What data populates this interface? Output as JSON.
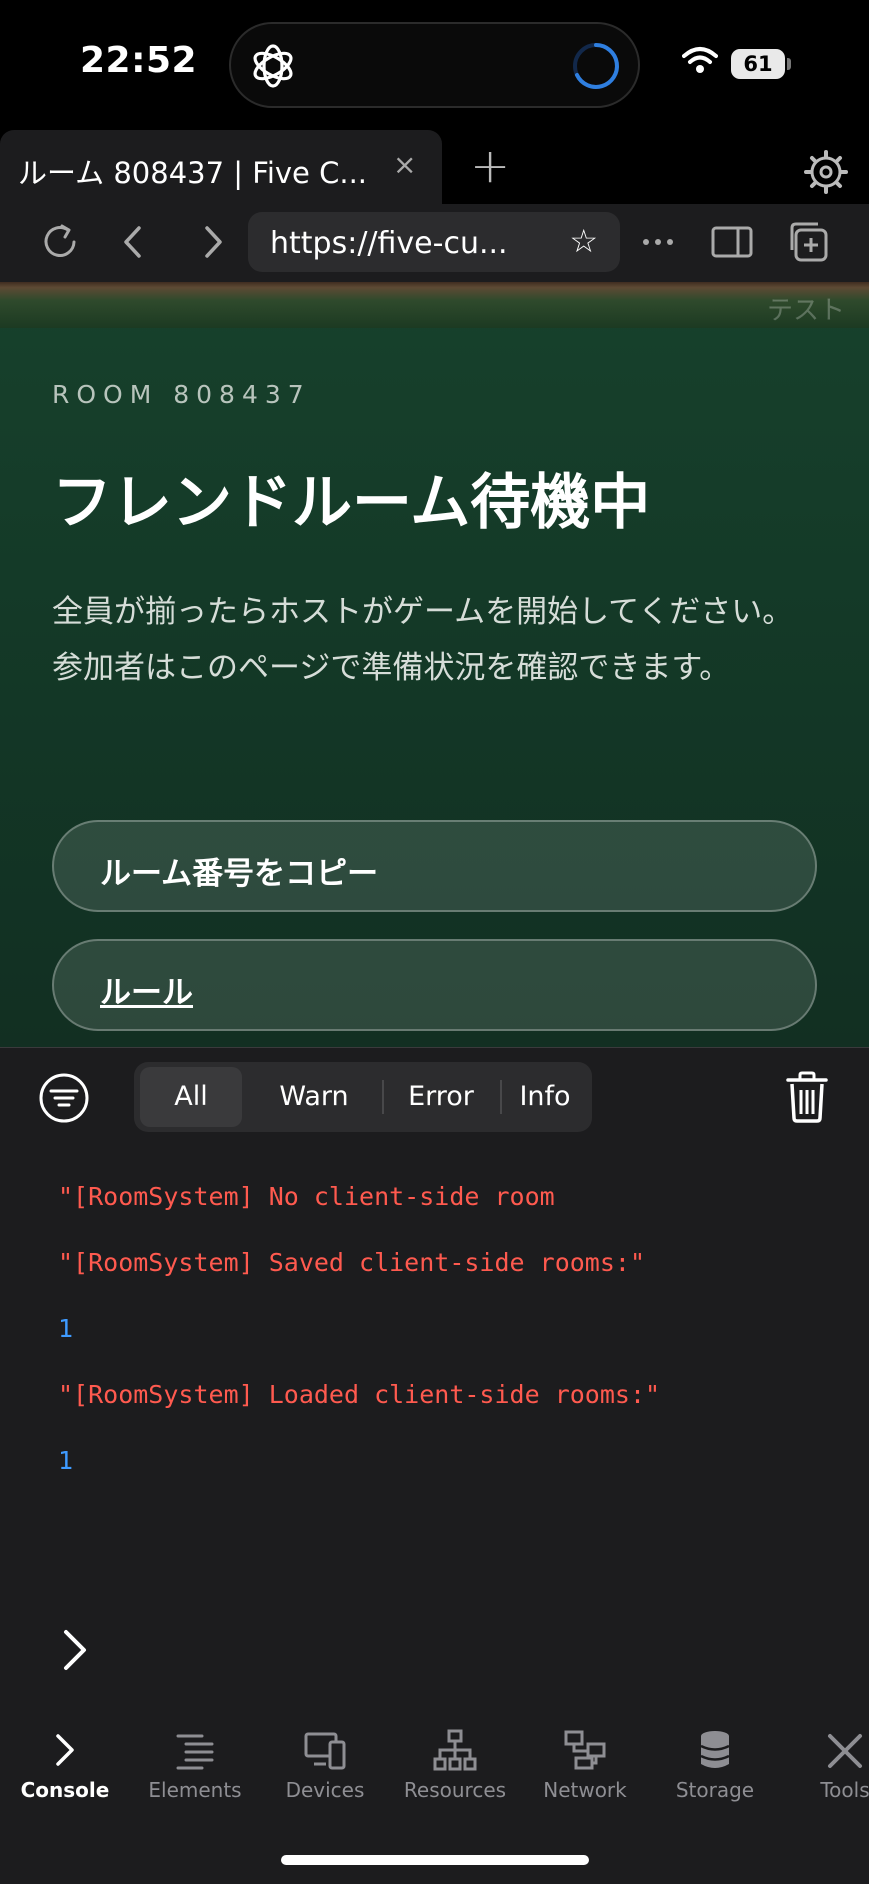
{
  "status_bar": {
    "time": "22:52",
    "battery": "61"
  },
  "browser": {
    "tab_title": "ルーム 808437 | Five C...",
    "tab_close": "×",
    "new_tab": "+",
    "url": "https://five-cu...",
    "bookmark_icon": "☆"
  },
  "page": {
    "banner_text": "テスト",
    "room_label": "ROOM 808437",
    "title": "フレンドルーム待機中",
    "description": "全員が揃ったらホストがゲームを開始してください。参加者はこのページで準備状況を確認できます。",
    "copy_button": "ルーム番号をコピー",
    "rules_button": "ルール"
  },
  "console": {
    "filters": [
      "All",
      "Warn",
      "Error",
      "Info"
    ],
    "active_filter": "All",
    "logs": [
      {
        "type": "string",
        "text": "\"[RoomSystem] No client-side room"
      },
      {
        "type": "string",
        "text": "\"[RoomSystem] Saved client-side rooms:\""
      },
      {
        "type": "number",
        "text": "1"
      },
      {
        "type": "string",
        "text": "\"[RoomSystem] Loaded client-side rooms:\""
      },
      {
        "type": "number",
        "text": "1"
      }
    ]
  },
  "bottom_nav": {
    "items": [
      {
        "label": "Console",
        "icon": "chevron-right-icon",
        "active": true
      },
      {
        "label": "Elements",
        "icon": "elements-icon",
        "active": false
      },
      {
        "label": "Devices",
        "icon": "devices-icon",
        "active": false
      },
      {
        "label": "Resources",
        "icon": "resources-icon",
        "active": false
      },
      {
        "label": "Network",
        "icon": "network-icon",
        "active": false
      },
      {
        "label": "Storage",
        "icon": "storage-icon",
        "active": false
      },
      {
        "label": "Tools",
        "icon": "tools-icon",
        "active": false
      }
    ]
  },
  "colors": {
    "console_string": "#ff5a4f",
    "console_number": "#3f9bff",
    "page_background": "#143a28"
  }
}
